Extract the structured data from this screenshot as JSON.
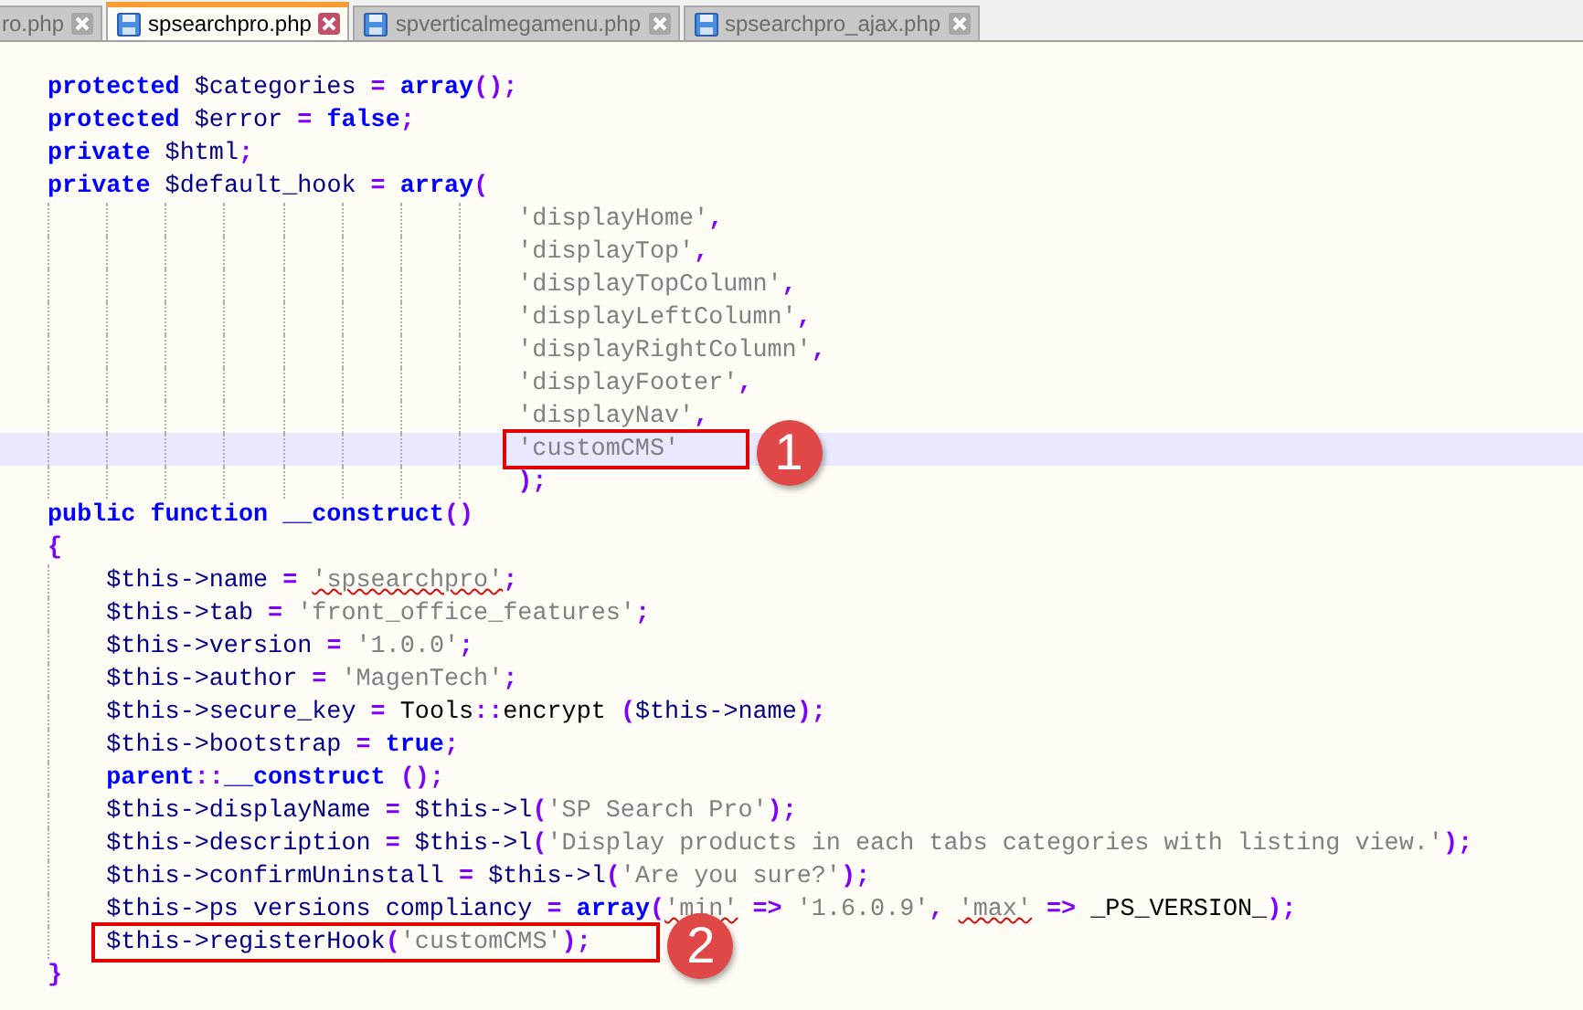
{
  "tabs": [
    {
      "label": "ro.php",
      "selected": false
    },
    {
      "label": "spsearchpro.php",
      "selected": true
    },
    {
      "label": "spverticalmegamenu.php",
      "selected": false
    },
    {
      "label": "spsearchpro_ajax.php",
      "selected": false
    }
  ],
  "editor": {
    "lines": [
      {
        "kind": "top",
        "selected": false,
        "tokens": [
          {
            "kind": "kw",
            "t": "protected "
          },
          {
            "kind": "var",
            "t": "$categories "
          },
          {
            "kind": "op",
            "t": "= "
          },
          {
            "kind": "kw",
            "t": "array"
          },
          {
            "kind": "op",
            "t": "();"
          }
        ]
      },
      {
        "kind": "top",
        "selected": false,
        "tokens": [
          {
            "kind": "kw",
            "t": "protected "
          },
          {
            "kind": "var",
            "t": "$error "
          },
          {
            "kind": "op",
            "t": "= "
          },
          {
            "kind": "kw",
            "t": "false"
          },
          {
            "kind": "op",
            "t": ";"
          }
        ]
      },
      {
        "kind": "top",
        "selected": false,
        "tokens": [
          {
            "kind": "kw",
            "t": "private "
          },
          {
            "kind": "var",
            "t": "$html"
          },
          {
            "kind": "op",
            "t": ";"
          }
        ]
      },
      {
        "kind": "top",
        "selected": false,
        "tokens": [
          {
            "kind": "kw",
            "t": "private "
          },
          {
            "kind": "var",
            "t": "$default_hook "
          },
          {
            "kind": "op",
            "t": "= "
          },
          {
            "kind": "kw",
            "t": "array"
          },
          {
            "kind": "op",
            "t": "("
          }
        ]
      },
      {
        "kind": "array_item",
        "selected": false,
        "tokens": [
          {
            "kind": "str",
            "t": "'displayHome'"
          },
          {
            "kind": "op",
            "t": ","
          }
        ]
      },
      {
        "kind": "array_item",
        "selected": false,
        "tokens": [
          {
            "kind": "str",
            "t": "'displayTop'"
          },
          {
            "kind": "op",
            "t": ","
          }
        ]
      },
      {
        "kind": "array_item",
        "selected": false,
        "tokens": [
          {
            "kind": "str",
            "t": "'displayTopColumn'"
          },
          {
            "kind": "op",
            "t": ","
          }
        ]
      },
      {
        "kind": "array_item",
        "selected": false,
        "tokens": [
          {
            "kind": "str",
            "t": "'displayLeftColumn'"
          },
          {
            "kind": "op",
            "t": ","
          }
        ]
      },
      {
        "kind": "array_item",
        "selected": false,
        "tokens": [
          {
            "kind": "str",
            "t": "'displayRightColumn'"
          },
          {
            "kind": "op",
            "t": ","
          }
        ]
      },
      {
        "kind": "array_item",
        "selected": false,
        "tokens": [
          {
            "kind": "str",
            "t": "'displayFooter'"
          },
          {
            "kind": "op",
            "t": ","
          }
        ]
      },
      {
        "kind": "array_item",
        "selected": false,
        "tokens": [
          {
            "kind": "str",
            "t": "'displayNav'"
          },
          {
            "kind": "op",
            "t": ","
          }
        ]
      },
      {
        "kind": "array_item",
        "selected": true,
        "callout": "1",
        "tokens": [
          {
            "kind": "str",
            "t": "'customCMS'"
          }
        ]
      },
      {
        "kind": "array_item",
        "selected": false,
        "tokens": [
          {
            "kind": "op",
            "t": ");"
          }
        ]
      },
      {
        "kind": "top",
        "selected": false,
        "tokens": [
          {
            "kind": "kw",
            "t": "public "
          },
          {
            "kind": "kw",
            "t": "function "
          },
          {
            "kind": "kw",
            "t": "__construct"
          },
          {
            "kind": "op",
            "t": "()"
          }
        ]
      },
      {
        "kind": "top",
        "selected": false,
        "tokens": [
          {
            "kind": "op",
            "t": "{"
          }
        ]
      },
      {
        "kind": "block",
        "selected": false,
        "tokens": [
          {
            "kind": "var",
            "t": "$this->name "
          },
          {
            "kind": "op",
            "t": "= "
          },
          {
            "kind": "str_err",
            "t": "'spsearchpro'"
          },
          {
            "kind": "op",
            "t": ";"
          }
        ]
      },
      {
        "kind": "block",
        "selected": false,
        "tokens": [
          {
            "kind": "var",
            "t": "$this->tab "
          },
          {
            "kind": "op",
            "t": "= "
          },
          {
            "kind": "str",
            "t": "'front_office_features'"
          },
          {
            "kind": "op",
            "t": ";"
          }
        ]
      },
      {
        "kind": "block",
        "selected": false,
        "tokens": [
          {
            "kind": "var",
            "t": "$this->version "
          },
          {
            "kind": "op",
            "t": "= "
          },
          {
            "kind": "str",
            "t": "'1.0.0'"
          },
          {
            "kind": "op",
            "t": ";"
          }
        ]
      },
      {
        "kind": "block",
        "selected": false,
        "tokens": [
          {
            "kind": "var",
            "t": "$this->author "
          },
          {
            "kind": "op",
            "t": "= "
          },
          {
            "kind": "str",
            "t": "'MagenTech'"
          },
          {
            "kind": "op",
            "t": ";"
          }
        ]
      },
      {
        "kind": "block",
        "selected": false,
        "tokens": [
          {
            "kind": "var",
            "t": "$this->secure_key "
          },
          {
            "kind": "op",
            "t": "= "
          },
          {
            "kind": "plain",
            "t": "Tools"
          },
          {
            "kind": "op",
            "t": "::"
          },
          {
            "kind": "plain",
            "t": "encrypt "
          },
          {
            "kind": "op",
            "t": "("
          },
          {
            "kind": "var",
            "t": "$this->name"
          },
          {
            "kind": "op",
            "t": ");"
          }
        ]
      },
      {
        "kind": "block",
        "selected": false,
        "tokens": [
          {
            "kind": "var",
            "t": "$this->bootstrap "
          },
          {
            "kind": "op",
            "t": "= "
          },
          {
            "kind": "kw",
            "t": "true"
          },
          {
            "kind": "op",
            "t": ";"
          }
        ]
      },
      {
        "kind": "block",
        "selected": false,
        "tokens": [
          {
            "kind": "kw",
            "t": "parent"
          },
          {
            "kind": "op",
            "t": "::"
          },
          {
            "kind": "kw",
            "t": "__construct "
          },
          {
            "kind": "op",
            "t": "();"
          }
        ]
      },
      {
        "kind": "block",
        "selected": false,
        "tokens": [
          {
            "kind": "var",
            "t": "$this->displayName "
          },
          {
            "kind": "op",
            "t": "= "
          },
          {
            "kind": "var",
            "t": "$this->l"
          },
          {
            "kind": "op",
            "t": "("
          },
          {
            "kind": "str",
            "t": "'SP Search Pro'"
          },
          {
            "kind": "op",
            "t": ");"
          }
        ]
      },
      {
        "kind": "block",
        "selected": false,
        "tokens": [
          {
            "kind": "var",
            "t": "$this->description "
          },
          {
            "kind": "op",
            "t": "= "
          },
          {
            "kind": "var",
            "t": "$this->l"
          },
          {
            "kind": "op",
            "t": "("
          },
          {
            "kind": "str",
            "t": "'Display products in each tabs categories with listing view.'"
          },
          {
            "kind": "op",
            "t": ");"
          }
        ]
      },
      {
        "kind": "block",
        "selected": false,
        "tokens": [
          {
            "kind": "var",
            "t": "$this->confirmUninstall "
          },
          {
            "kind": "op",
            "t": "= "
          },
          {
            "kind": "var",
            "t": "$this->l"
          },
          {
            "kind": "op",
            "t": "("
          },
          {
            "kind": "str",
            "t": "'Are you sure?'"
          },
          {
            "kind": "op",
            "t": ");"
          }
        ]
      },
      {
        "kind": "block",
        "selected": false,
        "tokens": [
          {
            "kind": "var",
            "t": "$this->ps versions compliancy "
          },
          {
            "kind": "op",
            "t": "= "
          },
          {
            "kind": "kw",
            "t": "array"
          },
          {
            "kind": "op",
            "t": "("
          },
          {
            "kind": "str_err",
            "t": "'min'"
          },
          {
            "kind": "op",
            "t": " => "
          },
          {
            "kind": "str",
            "t": "'1.6.0.9'"
          },
          {
            "kind": "op",
            "t": ", "
          },
          {
            "kind": "str_err",
            "t": "'max'"
          },
          {
            "kind": "op",
            "t": " => "
          },
          {
            "kind": "plain",
            "t": "_PS_VERSION_"
          },
          {
            "kind": "op",
            "t": ");"
          }
        ]
      },
      {
        "kind": "block",
        "selected": false,
        "callout": "2",
        "tokens": [
          {
            "kind": "var",
            "t": "$this->registerHook"
          },
          {
            "kind": "op",
            "t": "("
          },
          {
            "kind": "str",
            "t": "'customCMS'"
          },
          {
            "kind": "op",
            "t": ");"
          }
        ]
      },
      {
        "kind": "top",
        "selected": false,
        "tokens": [
          {
            "kind": "op",
            "t": "}"
          }
        ]
      }
    ]
  }
}
